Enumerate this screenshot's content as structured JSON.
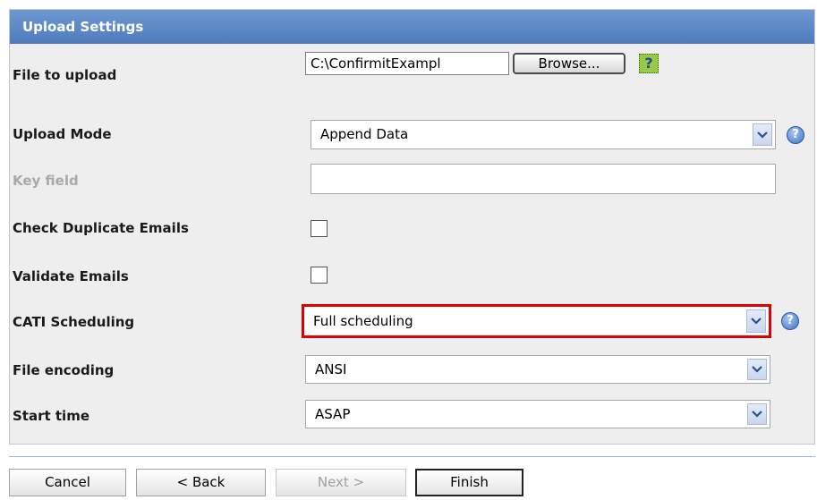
{
  "panel": {
    "title": "Upload Settings"
  },
  "fields": {
    "file_to_upload": {
      "label": "File to upload",
      "value": "C:\\ConfirmitExampl",
      "browse_label": "Browse...",
      "help_glyph": "?"
    },
    "upload_mode": {
      "label": "Upload Mode",
      "value": "Append Data"
    },
    "key_field": {
      "label": "Key field",
      "value": ""
    },
    "check_duplicate_emails": {
      "label": "Check Duplicate Emails",
      "checked": false
    },
    "validate_emails": {
      "label": "Validate Emails",
      "checked": false
    },
    "cati_scheduling": {
      "label": "CATI Scheduling",
      "value": "Full scheduling"
    },
    "file_encoding": {
      "label": "File encoding",
      "value": "ANSI"
    },
    "start_time": {
      "label": "Start time",
      "value": "ASAP"
    }
  },
  "help_glyph": "?",
  "buttons": {
    "cancel": "Cancel",
    "back": "< Back",
    "next": "Next >",
    "finish": "Finish"
  },
  "colors": {
    "header": "#5a86c6",
    "highlight_border": "#e00000",
    "panel_bg": "#eeeeee"
  }
}
